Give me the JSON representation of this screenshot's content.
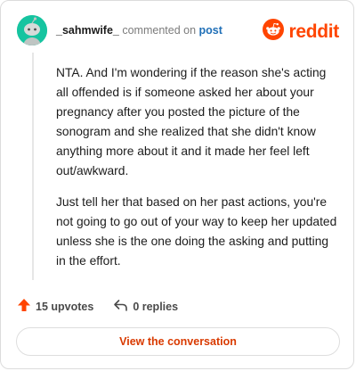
{
  "header": {
    "username": "_sahmwife_",
    "commented_text": "commented on",
    "post_link": "post"
  },
  "brand": {
    "name": "reddit",
    "color": "#ff4500",
    "icon": "reddit-logo-icon"
  },
  "avatar": {
    "color": "#16c4a0",
    "icon": "snoo-avatar-icon"
  },
  "comment": {
    "paragraphs": [
      "NTA. And I'm wondering if the reason she's acting all offended is if someone asked her about your pregnancy after you posted the picture of the sonogram and she realized that she didn't know anything more about it and it made her feel left out/awkward.",
      "Just tell her that based on her past actions, you're not going to go out of your way to keep her updated unless she is the one doing the asking and putting in the effort."
    ]
  },
  "actions": {
    "upvotes_label": "15 upvotes",
    "replies_label": "0 replies",
    "upvote_icon": "upvote-arrow-icon",
    "reply_icon": "reply-arrow-icon"
  },
  "cta": {
    "label": "View the conversation",
    "color": "#d93a00"
  }
}
